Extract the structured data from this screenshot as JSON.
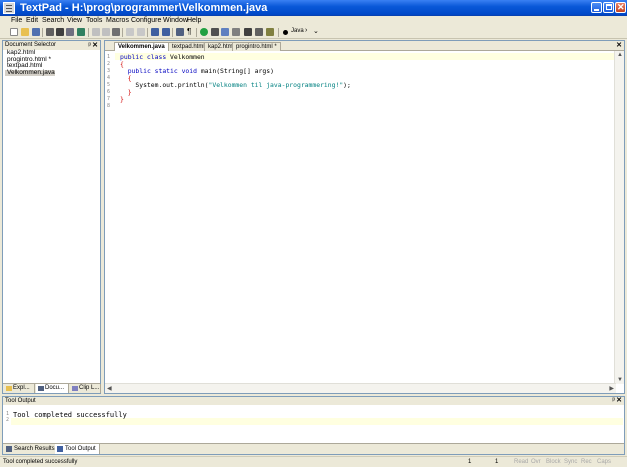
{
  "window": {
    "title": "TextPad - H:\\prog\\programmer\\Velkommen.java"
  },
  "menu": [
    "File",
    "Edit",
    "Search",
    "View",
    "Tools",
    "Macros",
    "Configure",
    "Window",
    "Help"
  ],
  "toolbar": {
    "java_label": "Java"
  },
  "document_selector": {
    "title": "Document Selector",
    "documents": [
      "kap2.html",
      "progintro.html *",
      "textpad.html",
      "Velkommen.java"
    ],
    "selected_index": 3,
    "tabs": [
      "Explorer",
      "Documents",
      "Clip Library"
    ],
    "tabs_display": [
      "Expl...",
      "Docu...",
      "Clip L..."
    ]
  },
  "editor": {
    "tabs": [
      "Velkommen.java",
      "textpad.html",
      "kap2.html",
      "progintro.html *"
    ],
    "active_tab": 0,
    "line_numbers": [
      "1",
      "2",
      "3",
      "4",
      "5",
      "6",
      "7",
      "8"
    ],
    "code": [
      {
        "parts": [
          [
            "kw",
            "public class"
          ],
          [
            "",
            " Velkommen"
          ]
        ]
      },
      {
        "parts": [
          [
            "br",
            "{"
          ]
        ]
      },
      {
        "parts": [
          [
            "",
            "  "
          ],
          [
            "kw",
            "public static void"
          ],
          [
            "",
            " main(String[] args)"
          ]
        ]
      },
      {
        "parts": [
          [
            "br",
            "  {"
          ]
        ]
      },
      {
        "parts": [
          [
            "",
            "    System.out.println("
          ],
          [
            "str",
            "\"Velkommen til java-programmering!\""
          ],
          [
            "",
            ");"
          ]
        ]
      },
      {
        "parts": [
          [
            "br",
            "  }"
          ]
        ]
      },
      {
        "parts": [
          [
            "br",
            "}"
          ]
        ]
      },
      {
        "parts": [
          [
            "",
            ""
          ]
        ]
      }
    ]
  },
  "tool_output": {
    "title": "Tool Output",
    "text": "Tool completed successfully",
    "tabs": [
      "Search Results",
      "Tool Output"
    ]
  },
  "status": {
    "message": "Tool completed successfully",
    "line": "1",
    "col": "1",
    "indicators": [
      "Read",
      "Ovr",
      "Block",
      "Sync",
      "Rec",
      "Caps"
    ]
  },
  "colors": {
    "keyword": "#0000c0",
    "brace": "#d00000",
    "string": "#008080",
    "title_bar": "#0a58d8"
  }
}
